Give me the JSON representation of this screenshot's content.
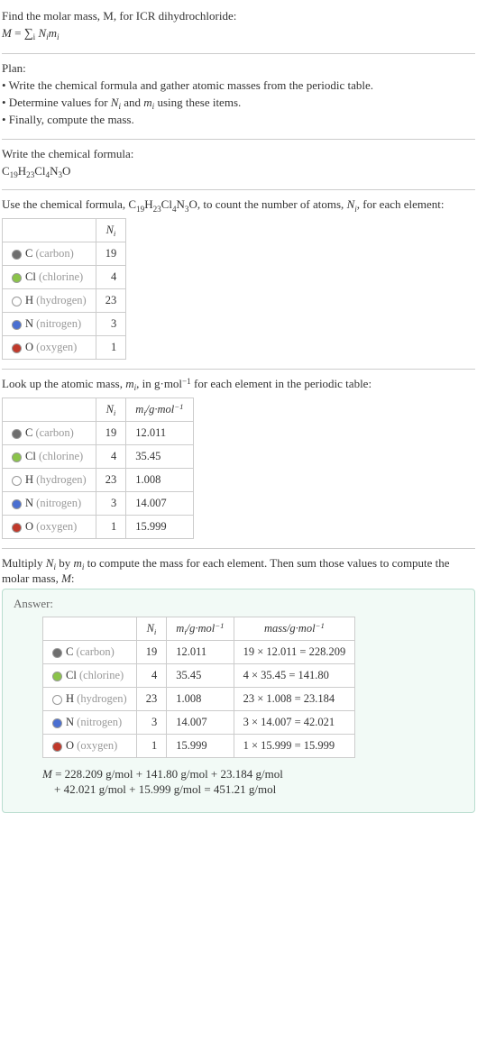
{
  "intro": {
    "line1": "Find the molar mass, M, for ICR dihydrochloride:",
    "eq_left": "M = ",
    "sigma": "∑",
    "subi": "i",
    "Nimi": "N_i m_i"
  },
  "plan": {
    "heading": "Plan:",
    "b1": "• Write the chemical formula and gather atomic masses from the periodic table.",
    "b2_a": "• Determine values for ",
    "b2_n": "N_i",
    "b2_and": " and ",
    "b2_m": "m_i",
    "b2_end": " using these items.",
    "b3": "• Finally, compute the mass."
  },
  "formula": {
    "heading": "Write the chemical formula:",
    "text": "C_19 H_23 Cl_4 N_3 O"
  },
  "count_intro_a": "Use the chemical formula, ",
  "count_intro_b": ", to count the number of atoms, ",
  "count_foreach": ", for each element:",
  "elements": [
    {
      "sym": "C",
      "name": "(carbon)",
      "color": "#6e6e6e",
      "Ni": "19",
      "mi": "12.011",
      "mass": "19 × 12.011 = 228.209"
    },
    {
      "sym": "Cl",
      "name": "(chlorine)",
      "color": "#8bc34a",
      "Ni": "4",
      "mi": "35.45",
      "mass": "4 × 35.45 = 141.80"
    },
    {
      "sym": "H",
      "name": "(hydrogen)",
      "color": "#ffffff",
      "Ni": "23",
      "mi": "1.008",
      "mass": "23 × 1.008 = 23.184"
    },
    {
      "sym": "N",
      "name": "(nitrogen)",
      "color": "#4a6fd1",
      "Ni": "3",
      "mi": "14.007",
      "mass": "3 × 14.007 = 42.021"
    },
    {
      "sym": "O",
      "name": "(oxygen)",
      "color": "#c0392b",
      "Ni": "1",
      "mi": "15.999",
      "mass": "1 × 15.999 = 15.999"
    }
  ],
  "mi_intro_a": "Look up the atomic mass, ",
  "mi_intro_b": ", in g·mol",
  "mi_intro_c": " for each element in the periodic table:",
  "headers": {
    "Ni": "N_i",
    "mi_unit": "m_i /g·mol^-1",
    "mass_unit": "mass/g·mol^-1"
  },
  "multiply_intro_a": "Multiply ",
  "multiply_intro_b": " by ",
  "multiply_intro_c": " to compute the mass for each element. Then sum those values to compute the molar mass, ",
  "Mcolon": "M:",
  "answer_label": "Answer:",
  "final_line1": "M = 228.209 g/mol + 141.80 g/mol + 23.184 g/mol",
  "final_line2": "+ 42.021 g/mol + 15.999 g/mol = 451.21 g/mol"
}
